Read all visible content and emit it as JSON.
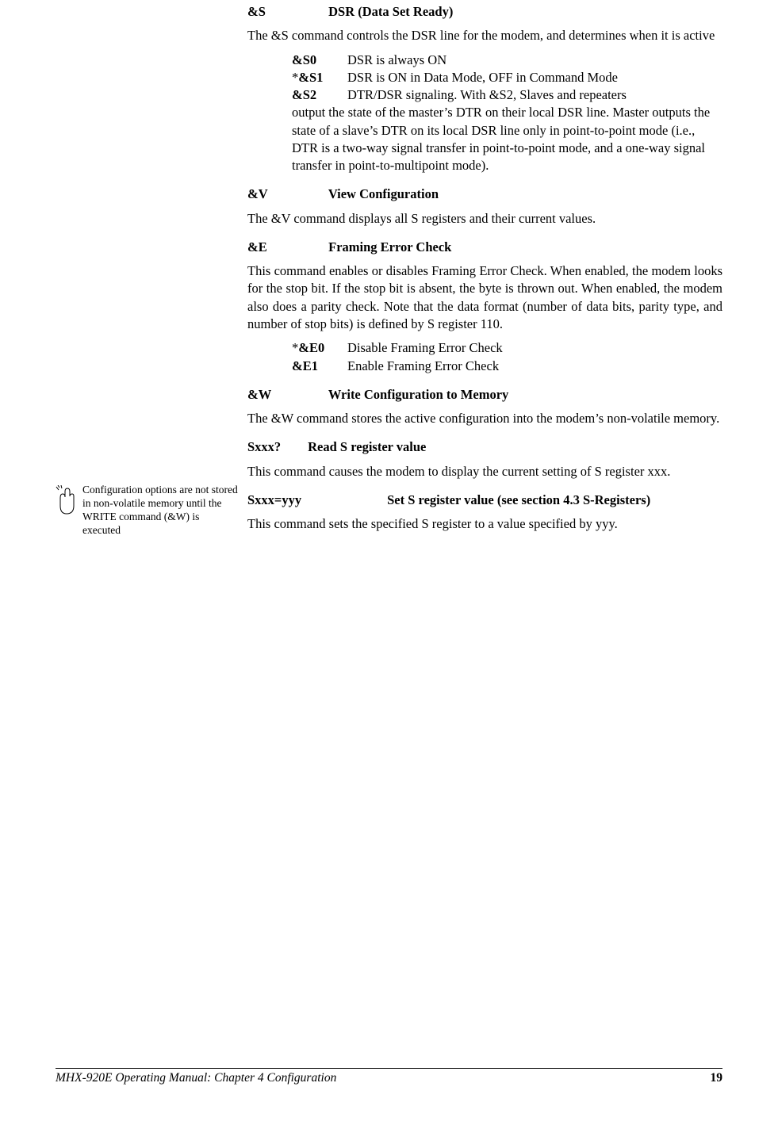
{
  "margin": {
    "note": "Configuration options are not stored in non-volatile memory until the WRITE command (&W) is executed"
  },
  "s_cmd": {
    "cmd": "&S",
    "title": "DSR (Data Set Ready)",
    "desc": "The &S command controls the DSR line for the modem, and determines when it is active",
    "opts": {
      "c0": "&S0",
      "d0": "DSR is always ON",
      "c1": "*&S1",
      "d1": "DSR is ON in Data Mode, OFF in Command Mode",
      "c2": "&S2",
      "d2": "DTR/DSR signaling.  With &S2, Slaves and repeaters",
      "cont": "output the state of the master’s DTR on their local DSR line.  Master outputs the state of a slave’s DTR on its local DSR line only in point-to-point mode (i.e., DTR is a two-way signal transfer in point-to-point mode, and a one-way signal transfer in point-to-multipoint mode)."
    }
  },
  "v_cmd": {
    "cmd": "&V",
    "title": "View Configuration",
    "desc": "The &V command displays all S registers and their current values."
  },
  "e_cmd": {
    "cmd": "&E",
    "title": "Framing Error Check",
    "desc": "This command enables or disables Framing Error Check.  When enabled, the modem looks for the stop bit.  If the stop bit is absent, the byte is thrown out.  When enabled, the modem also does a parity check.  Note that the data format (number of data bits, parity type, and number of stop bits) is defined by S register 110.",
    "opts": {
      "c0": "*&E0",
      "d0": "Disable Framing Error Check",
      "c1": "&E1",
      "d1": "Enable Framing Error Check"
    }
  },
  "w_cmd": {
    "cmd": "&W",
    "title": "Write Configuration to Memory",
    "desc": "The &W command stores the active configuration into the modem’s non-volatile memory."
  },
  "sread": {
    "cmd": "Sxxx?",
    "title": "Read S register value",
    "desc": "This command causes the modem to display the current setting of S register xxx."
  },
  "sset": {
    "cmd": "Sxxx=yyy",
    "title": "Set S register value (see section 4.3 S-Registers)",
    "desc": "This command sets the specified S register to a value specified by yyy."
  },
  "footer": {
    "left": "MHX-920E Operating Manual: Chapter 4 Configuration",
    "page": "19"
  }
}
